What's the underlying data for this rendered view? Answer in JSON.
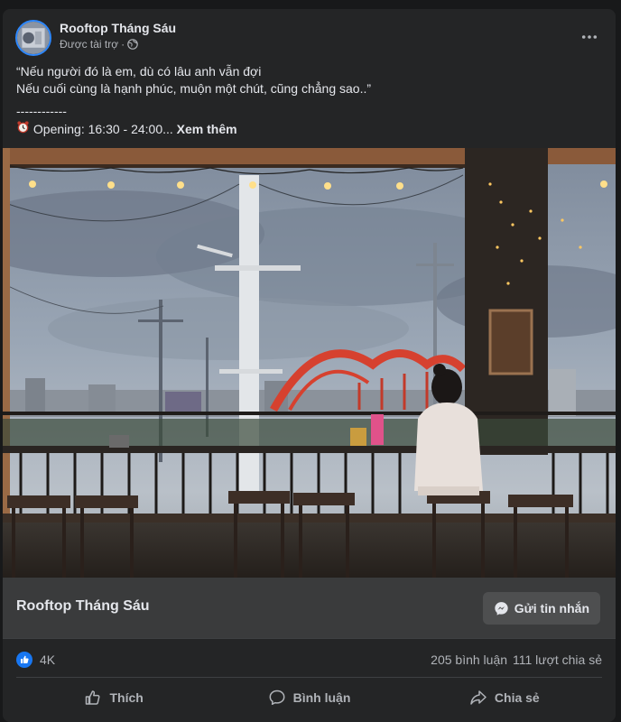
{
  "post": {
    "page_name": "Rooftop Tháng Sáu",
    "sponsored_label": "Được tài trợ",
    "meta_separator": "·",
    "more_icon": "more-horizontal-icon",
    "caption": {
      "line1": "“Nếu người đó là em, dù có lâu anh vẫn đợi",
      "line2": "Nếu cuối cùng là hạnh phúc, muộn một chút, cũng chẳng sao..”",
      "separator": "------------",
      "opening": "Opening: 16:30 - 24:00...",
      "see_more": "Xem thêm"
    }
  },
  "cta": {
    "title": "Rooftop Tháng Sáu",
    "button_label": "Gửi tin nhắn"
  },
  "stats": {
    "reaction_count": "4K",
    "comments": "205 bình luận",
    "shares": "111 lượt chia sẻ"
  },
  "actions": {
    "like": "Thích",
    "comment": "Bình luận",
    "share": "Chia sẻ"
  },
  "colors": {
    "card_bg": "#242526",
    "cta_bg": "#3a3b3c",
    "like_blue": "#1877f2",
    "text_primary": "#e4e6eb",
    "text_secondary": "#b0b3b8"
  }
}
